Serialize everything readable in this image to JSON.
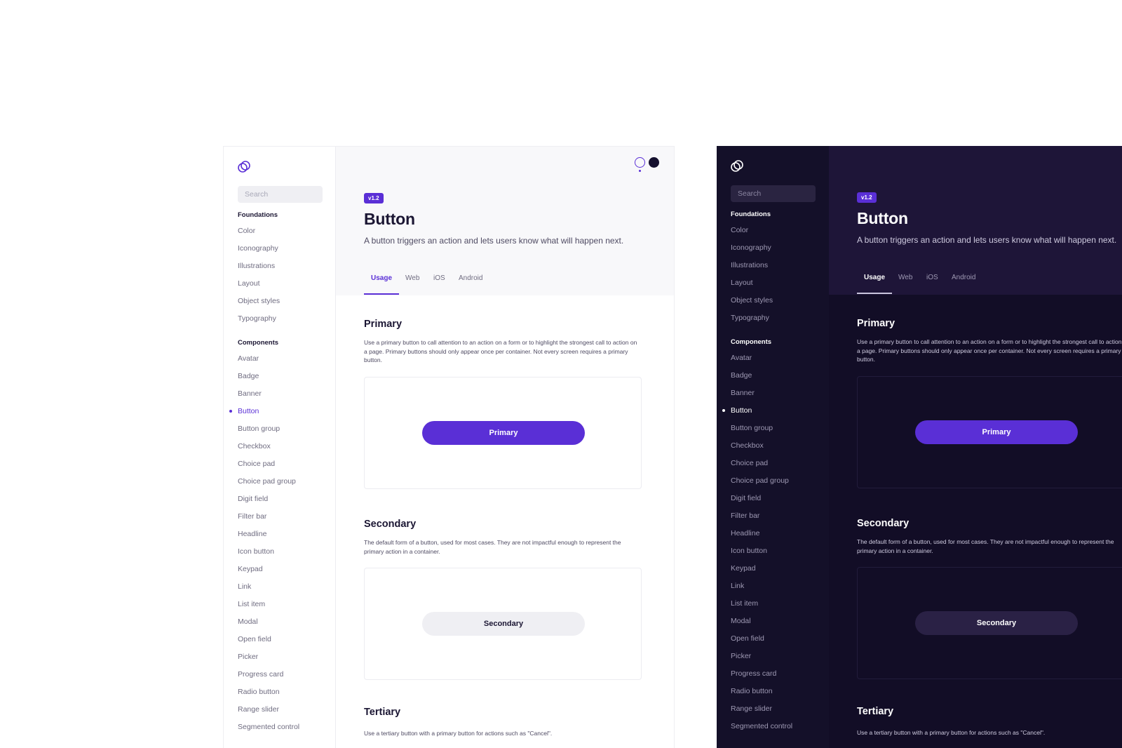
{
  "search_placeholder": "Search",
  "sidebar": {
    "foundations_label": "Foundations",
    "foundations": [
      "Color",
      "Iconography",
      "Illustrations",
      "Layout",
      "Object styles",
      "Typography"
    ],
    "components_label": "Components",
    "components": [
      "Avatar",
      "Badge",
      "Banner",
      "Button",
      "Button group",
      "Checkbox",
      "Choice pad",
      "Choice pad group",
      "Digit field",
      "Filter bar",
      "Headline",
      "Icon button",
      "Keypad",
      "Link",
      "List item",
      "Modal",
      "Open field",
      "Picker",
      "Progress card",
      "Radio button",
      "Range slider",
      "Segmented control"
    ],
    "active_item": "Button"
  },
  "page": {
    "version_badge": "v1.2",
    "title": "Button",
    "description": "A button triggers an action and lets users know what will happen next."
  },
  "tabs": [
    "Usage",
    "Web",
    "iOS",
    "Android"
  ],
  "active_tab": "Usage",
  "sections": {
    "primary": {
      "title": "Primary",
      "description": "Use a primary button to call attention to an action on a form or to highlight the strongest call to action on a page. Primary buttons should only appear once per container. Not every screen requires a primary button.",
      "button_label": "Primary"
    },
    "secondary": {
      "title": "Secondary",
      "description": "The default form of a button, used for most cases. They are not impactful enough to represent the primary action in a container.",
      "button_label": "Secondary"
    },
    "tertiary": {
      "title": "Tertiary",
      "description": "Use a tertiary button with a primary button for actions such as \"Cancel\"."
    }
  },
  "colors": {
    "accent": "#5a2fd6",
    "dark_background": "#120d26",
    "dark_header": "#1e1538",
    "light_header": "#f8f8fa"
  },
  "icons": {
    "logo": "overlapping-circles-logo-icon",
    "theme_light": "light-theme-icon",
    "theme_dark": "dark-theme-icon"
  }
}
